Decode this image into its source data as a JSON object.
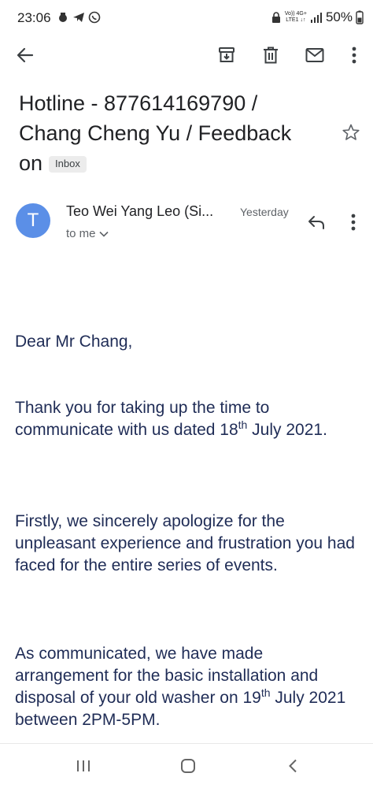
{
  "status_bar": {
    "time": "23:06",
    "network_top": "Vo)) 4G+",
    "network_bottom": "LTE1 ↓↑",
    "battery": "50%"
  },
  "email": {
    "subject_line1": "Hotline - 877614169790 /",
    "subject_line2": "Chang Cheng Yu / Feedback",
    "subject_line3": "on",
    "label": "Inbox",
    "sender_initial": "T",
    "sender_name": "Teo Wei Yang Leo (Si...",
    "date": "Yesterday",
    "recipient": "to me",
    "greeting": "Dear Mr Chang,",
    "para1_a": "Thank you for taking up the time to communicate with us dated 18",
    "para1_sup": "th",
    "para1_b": " July 2021.",
    "para2": "Firstly, we sincerely apologize for the unpleasant experience and frustration you had faced for the entire series of events.",
    "para3_a": "As communicated, we have made arrangement for the basic installation and disposal of your old washer on 19",
    "para3_sup": "th",
    "para3_b": " July 2021 between 2PM-5PM."
  },
  "colors": {
    "avatar": "#5b8fe7",
    "body_text": "#1f2c56",
    "icon": "#5f6368"
  },
  "icons": [
    "back-arrow-icon",
    "archive-icon",
    "delete-icon",
    "mail-icon",
    "more-vert-icon",
    "star-icon",
    "reply-icon",
    "chevron-down-icon"
  ]
}
